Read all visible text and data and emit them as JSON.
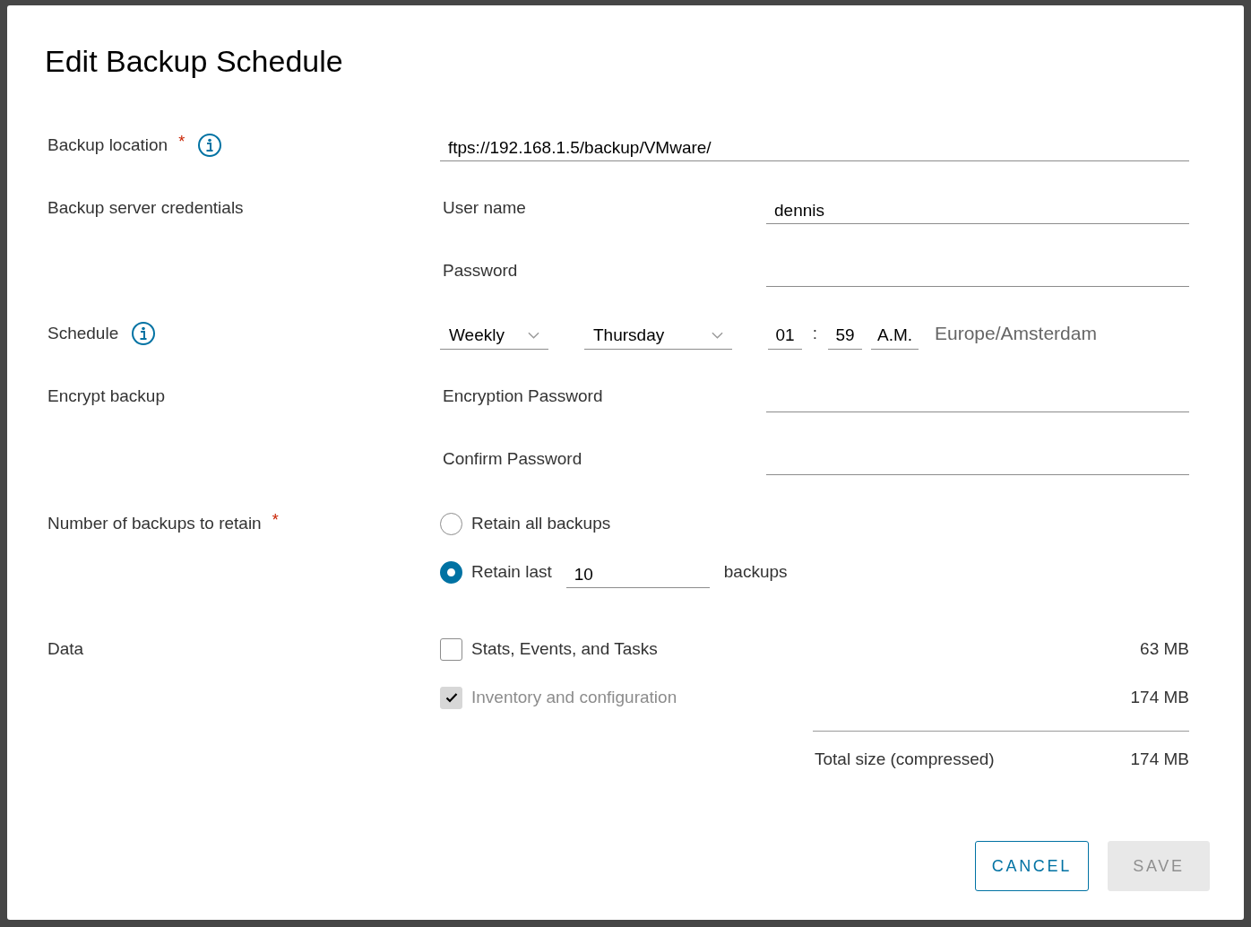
{
  "dialog": {
    "title": "Edit Backup Schedule",
    "location": {
      "label": "Backup location",
      "required_mark": "*",
      "info": true,
      "value": "ftps://192.168.1.5/backup/VMware/"
    },
    "credentials": {
      "label": "Backup server credentials",
      "fields": [
        {
          "label": "User name",
          "value": "dennis"
        },
        {
          "label": "Password"
        }
      ]
    },
    "schedule": {
      "label": "Schedule",
      "info": true,
      "frequency": "Weekly",
      "day": "Thursday",
      "hour": "01",
      "separator": ":",
      "minute": "59",
      "meridiem": "A.M.",
      "timezone": "Europe/Amsterdam"
    },
    "encrypt": {
      "label": "Encrypt backup",
      "fields": [
        {
          "label": "Encryption Password"
        },
        {
          "label": "Confirm Password"
        }
      ]
    },
    "retain": {
      "label": "Number of backups to retain",
      "required_mark": "*",
      "options": [
        {
          "kind": "all",
          "label": "Retain all backups",
          "selected": false
        },
        {
          "kind": "last",
          "label": "Retain last",
          "count": "10",
          "suffix": "backups",
          "selected": true
        }
      ]
    },
    "data": {
      "label": "Data",
      "items": [
        {
          "label": "Stats, Events, and Tasks",
          "size": "63 MB",
          "checked": false,
          "disabled": false
        },
        {
          "label": "Inventory and configuration",
          "size": "174 MB",
          "checked": true,
          "disabled": true
        }
      ],
      "total_label": "Total size (compressed)",
      "total_size": "174 MB"
    },
    "buttons": [
      {
        "label": "CANCEL",
        "disabled": false
      },
      {
        "label": "SAVE",
        "disabled": true
      }
    ]
  }
}
